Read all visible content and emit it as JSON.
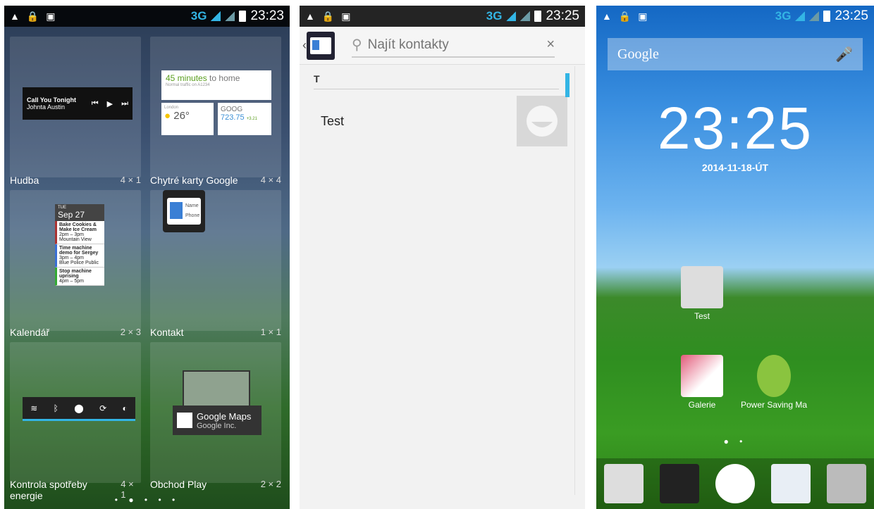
{
  "status1": {
    "net": "3G",
    "time": "23:23"
  },
  "status2": {
    "net": "3G",
    "time": "23:25"
  },
  "status3": {
    "net": "3G",
    "time": "23:25"
  },
  "widgets": [
    {
      "label": "Hudba",
      "size": "4 × 1"
    },
    {
      "label": "Chytré karty Google",
      "size": "4 × 4"
    },
    {
      "label": "Kalendář",
      "size": "2 × 3"
    },
    {
      "label": "Kontakt",
      "size": "1 × 1"
    },
    {
      "label": "Kontrola spotřeby energie",
      "size": "4 × 1"
    },
    {
      "label": "Obchod Play",
      "size": "2 × 2"
    }
  ],
  "music": {
    "title": "Call You Tonight",
    "artist": "Johnta Austin"
  },
  "gnow": {
    "commute": "45 minutes",
    "commute_suffix": "to home",
    "traffic": "Normal traffic on A1234",
    "city": "London",
    "temp": "26°",
    "stock": "GOOG",
    "price": "723.75",
    "change": "+3.21"
  },
  "calendar": {
    "day": "TUE",
    "date": "Sep 27",
    "events": [
      {
        "title": "Bake Cookies & Make Ice Cream",
        "time": "2pm – 3pm",
        "place": "Mountain View"
      },
      {
        "title": "Time machine demo for Sergey",
        "time": "3pm – 4pm",
        "place": "Blue Police Public"
      },
      {
        "title": "Stop machine uprising",
        "time": "4pm – 5pm",
        "place": ""
      }
    ]
  },
  "maps": {
    "title": "Google Maps",
    "dev": "Google Inc."
  },
  "contacts": {
    "search_placeholder": "Najít kontakty",
    "section": "T",
    "contact_name": "Test"
  },
  "home": {
    "search_brand": "Google",
    "clock": "23:25",
    "date": "2014-11-18-ÚT",
    "icons": [
      "Test",
      "Galerie",
      "Power Saving Ma"
    ]
  }
}
